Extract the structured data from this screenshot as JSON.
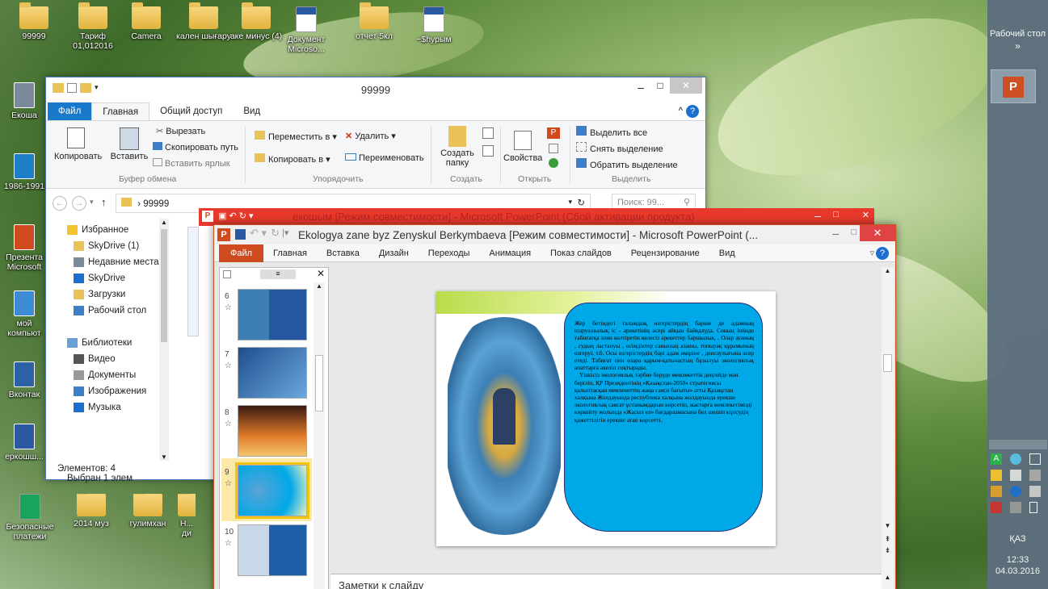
{
  "desktop": {
    "icons_top": [
      {
        "label": "99999",
        "type": "folder"
      },
      {
        "label": "Тариф 01,012016",
        "type": "folder"
      },
      {
        "label": "Camera",
        "type": "folder"
      },
      {
        "label": "кален шығару",
        "type": "folder"
      },
      {
        "label": "аке минус (4)",
        "type": "folder"
      },
      {
        "label": "Документ Microso...",
        "type": "word"
      },
      {
        "label": "отчет 5кл",
        "type": "folder"
      },
      {
        "label": "~$һурым",
        "type": "word"
      }
    ],
    "icons_left": [
      {
        "label": "Екоша"
      },
      {
        "label": "1986-1991"
      },
      {
        "label": "Презента Microsoft"
      },
      {
        "label": "мой компьют"
      },
      {
        "label": "Вконтак"
      },
      {
        "label": "еркошш..."
      }
    ],
    "icons_bottom": [
      {
        "label": "Безопасные платежи"
      },
      {
        "label": "2014 муз"
      },
      {
        "label": "гулимхан"
      },
      {
        "label": "Н... ди"
      }
    ]
  },
  "taskbar": {
    "toolbar_label": "Рабочий стол",
    "chevron": "»",
    "language": "ҚАЗ",
    "time": "12:33",
    "date": "04.03.2016"
  },
  "explorer": {
    "title": "99999",
    "tabs": [
      "Файл",
      "Главная",
      "Общий доступ",
      "Вид"
    ],
    "clipboard": {
      "copy": "Копировать",
      "paste": "Вставить",
      "cut": "Вырезать",
      "copy_path": "Скопировать путь",
      "paste_shortcut": "Вставить ярлык",
      "group": "Буфер обмена"
    },
    "organize": {
      "move": "Переместить в ▾",
      "copy_to": "Копировать в ▾",
      "delete": "Удалить ▾",
      "rename": "Переименовать",
      "group": "Упорядочить"
    },
    "create": {
      "new_folder": "Создать папку",
      "group": "Создать"
    },
    "open": {
      "properties": "Свойства",
      "group": "Открыть"
    },
    "select": {
      "select_all": "Выделить все",
      "select_none": "Снять выделение",
      "invert": "Обратить выделение",
      "group": "Выделить"
    },
    "address": "99999",
    "search_placeholder": "Поиск: 99...",
    "nav": [
      {
        "label": "Избранное",
        "icon": "star-icon"
      },
      {
        "label": "SkyDrive (1)",
        "icon": "folder-icon"
      },
      {
        "label": "Недавние места",
        "icon": "recent-icon"
      },
      {
        "label": "SkyDrive",
        "icon": "cloud-icon"
      },
      {
        "label": "Загрузки",
        "icon": "download-icon"
      },
      {
        "label": "Рабочий стол",
        "icon": "desktop-icon"
      },
      {
        "label": "Библиотеки",
        "icon": "library-icon"
      },
      {
        "label": "Видео",
        "icon": "video-icon"
      },
      {
        "label": "Документы",
        "icon": "document-icon"
      },
      {
        "label": "Изображения",
        "icon": "image-icon"
      },
      {
        "label": "Музыка",
        "icon": "music-icon"
      }
    ],
    "status_items": "Элементов: 4",
    "status_selected": "Выбран 1 элем"
  },
  "ppt_back": {
    "title": "екошым [Режим совместимости] - Microsoft PowerPoint (Сбой активации продукта)"
  },
  "ppt": {
    "title": "Ekologya zane byz Zenyskul Berkymbaeva [Режим совместимости] - Microsoft PowerPoint (...",
    "menu": [
      "Файл",
      "Главная",
      "Вставка",
      "Дизайн",
      "Переходы",
      "Анимация",
      "Показ слайдов",
      "Рецензирование",
      "Вид"
    ],
    "thumbnails": [
      "6",
      "7",
      "8",
      "9",
      "10"
    ],
    "slide_text_1": "Жер бетіндегі ғаламдық өзгерістердің бәріне де адамның шаруашылық іс - әрекетінің әсері айқын байқалуда. Соның ішінде табиғатқа зиян келтіретін келесіз әрекеттер баршылық. . Олар ауаның , судың ластануы , өсімдіктер санының азаюы, топырақ құрамының өзгеруі, т.б. Осы өзгерістердің бәрі адам өміріне , денсаулығына әсер етеді. Табиғат пен өзара қарым-қатынастың бұзылуы экологиялық апаттарға әкеліп соқтырады.",
    "slide_text_2": "Үшкісіз экологиялық тәрбие беруде мемлекеттік деңгейде мән беріліп, ҚР Президентінің «Қазақстан-2050» стратегиясы қалыптасқан мемлекеттің жаңа саяси бағыты» атты Қазақстан халқына Жолдауында республика халқына жолдауында ерекше экологиялық саясат ұстанымдарын көрсетіп, жастарға мемлекетімізді көркейту жолында «Жасыл ел» бағдарламасына бел шешіп кірісудің қажеттілігін ерекше атап көрсетті.",
    "notes": "Заметки к слайду"
  }
}
